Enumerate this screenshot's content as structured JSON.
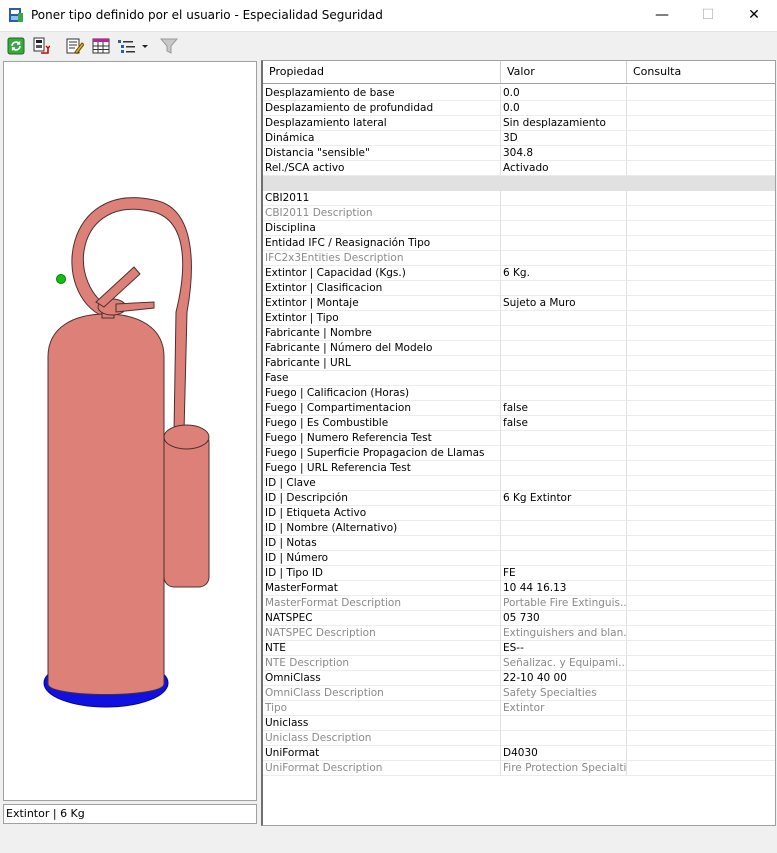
{
  "window": {
    "title": "Poner tipo definido por el usuario - Especialidad Seguridad",
    "minimize_glyph": "—",
    "maximize_glyph": "☐",
    "close_glyph": "✕"
  },
  "toolbar": {
    "buttons": [
      "refresh-icon",
      "load-type-icon",
      "edit-properties-icon",
      "table-view-icon",
      "list-view-dropdown-icon",
      "filter-icon"
    ]
  },
  "preview": {
    "status": "Extintor | 6 Kg"
  },
  "grid": {
    "headers": [
      "Propiedad",
      "Valor",
      "Consulta"
    ],
    "rows": [
      {
        "p": "Desplazamiento de base",
        "v": "0.0",
        "c": ""
      },
      {
        "p": "Desplazamiento de profundidad",
        "v": "0.0",
        "c": ""
      },
      {
        "p": "Desplazamiento lateral",
        "v": "Sin desplazamiento",
        "c": ""
      },
      {
        "p": "Dinámica",
        "v": "3D",
        "c": ""
      },
      {
        "p": "Distancia \"sensible\"",
        "v": "304.8",
        "c": ""
      },
      {
        "p": "Rel./SCA activo",
        "v": "Activado",
        "c": ""
      },
      {
        "p": "",
        "v": "",
        "c": "",
        "sep": true
      },
      {
        "p": "CBI2011",
        "v": "",
        "c": ""
      },
      {
        "p": "CBI2011 Description",
        "v": "",
        "c": "",
        "gray": true
      },
      {
        "p": "Disciplina",
        "v": "",
        "c": ""
      },
      {
        "p": "Entidad IFC / Reasignación Tipo",
        "v": "",
        "c": ""
      },
      {
        "p": "IFC2x3Entities Description",
        "v": "",
        "c": "",
        "gray": true
      },
      {
        "p": "Extintor | Capacidad (Kgs.)",
        "v": "6 Kg.",
        "c": ""
      },
      {
        "p": "Extintor | Clasificacion",
        "v": "",
        "c": ""
      },
      {
        "p": "Extintor | Montaje",
        "v": "Sujeto a Muro",
        "c": ""
      },
      {
        "p": "Extintor | Tipo",
        "v": "",
        "c": ""
      },
      {
        "p": "Fabricante | Nombre",
        "v": "",
        "c": ""
      },
      {
        "p": "Fabricante | Número del Modelo",
        "v": "",
        "c": ""
      },
      {
        "p": "Fabricante | URL",
        "v": "",
        "c": ""
      },
      {
        "p": "Fase",
        "v": "",
        "c": ""
      },
      {
        "p": "Fuego | Calificacion (Horas)",
        "v": "",
        "c": ""
      },
      {
        "p": "Fuego | Compartimentacion",
        "v": "false",
        "c": ""
      },
      {
        "p": "Fuego | Es Combustible",
        "v": "false",
        "c": ""
      },
      {
        "p": "Fuego | Numero Referencia Test",
        "v": "",
        "c": ""
      },
      {
        "p": "Fuego | Superficie Propagacion de Llamas",
        "v": "",
        "c": ""
      },
      {
        "p": "Fuego | URL Referencia Test",
        "v": "",
        "c": ""
      },
      {
        "p": "ID | Clave",
        "v": "",
        "c": ""
      },
      {
        "p": "ID | Descripción",
        "v": "6 Kg Extintor",
        "c": ""
      },
      {
        "p": "ID | Etiqueta Activo",
        "v": "",
        "c": ""
      },
      {
        "p": "ID | Nombre (Alternativo)",
        "v": "",
        "c": ""
      },
      {
        "p": "ID | Notas",
        "v": "",
        "c": ""
      },
      {
        "p": "ID | Número",
        "v": "",
        "c": ""
      },
      {
        "p": "ID | Tipo ID",
        "v": "FE",
        "c": ""
      },
      {
        "p": "MasterFormat",
        "v": "10 44 16.13",
        "c": ""
      },
      {
        "p": "MasterFormat Description",
        "v": "Portable Fire Extinguis...",
        "c": "",
        "gray": true
      },
      {
        "p": "NATSPEC",
        "v": "05 730",
        "c": ""
      },
      {
        "p": "NATSPEC Description",
        "v": "Extinguishers and blan...",
        "c": "",
        "gray": true
      },
      {
        "p": "NTE",
        "v": "ES--",
        "c": ""
      },
      {
        "p": "NTE Description",
        "v": "Señalizac. y Equipami...",
        "c": "",
        "gray": true
      },
      {
        "p": "OmniClass",
        "v": "22-10 40 00",
        "c": ""
      },
      {
        "p": "OmniClass Description",
        "v": "Safety Specialties",
        "c": "",
        "gray": true
      },
      {
        "p": "Tipo",
        "v": "Extintor",
        "c": "",
        "gray": true
      },
      {
        "p": "Uniclass",
        "v": "",
        "c": ""
      },
      {
        "p": "Uniclass Description",
        "v": "",
        "c": "",
        "gray": true
      },
      {
        "p": "UniFormat",
        "v": "D4030",
        "c": ""
      },
      {
        "p": "UniFormat Description",
        "v": "Fire Protection Specialties",
        "c": "",
        "gray": true
      }
    ]
  },
  "colors": {
    "extinguisher_body": "#dc8078",
    "extinguisher_outline": "#4a3030",
    "base_ring": "#1010e0",
    "marker": "#10c010"
  }
}
